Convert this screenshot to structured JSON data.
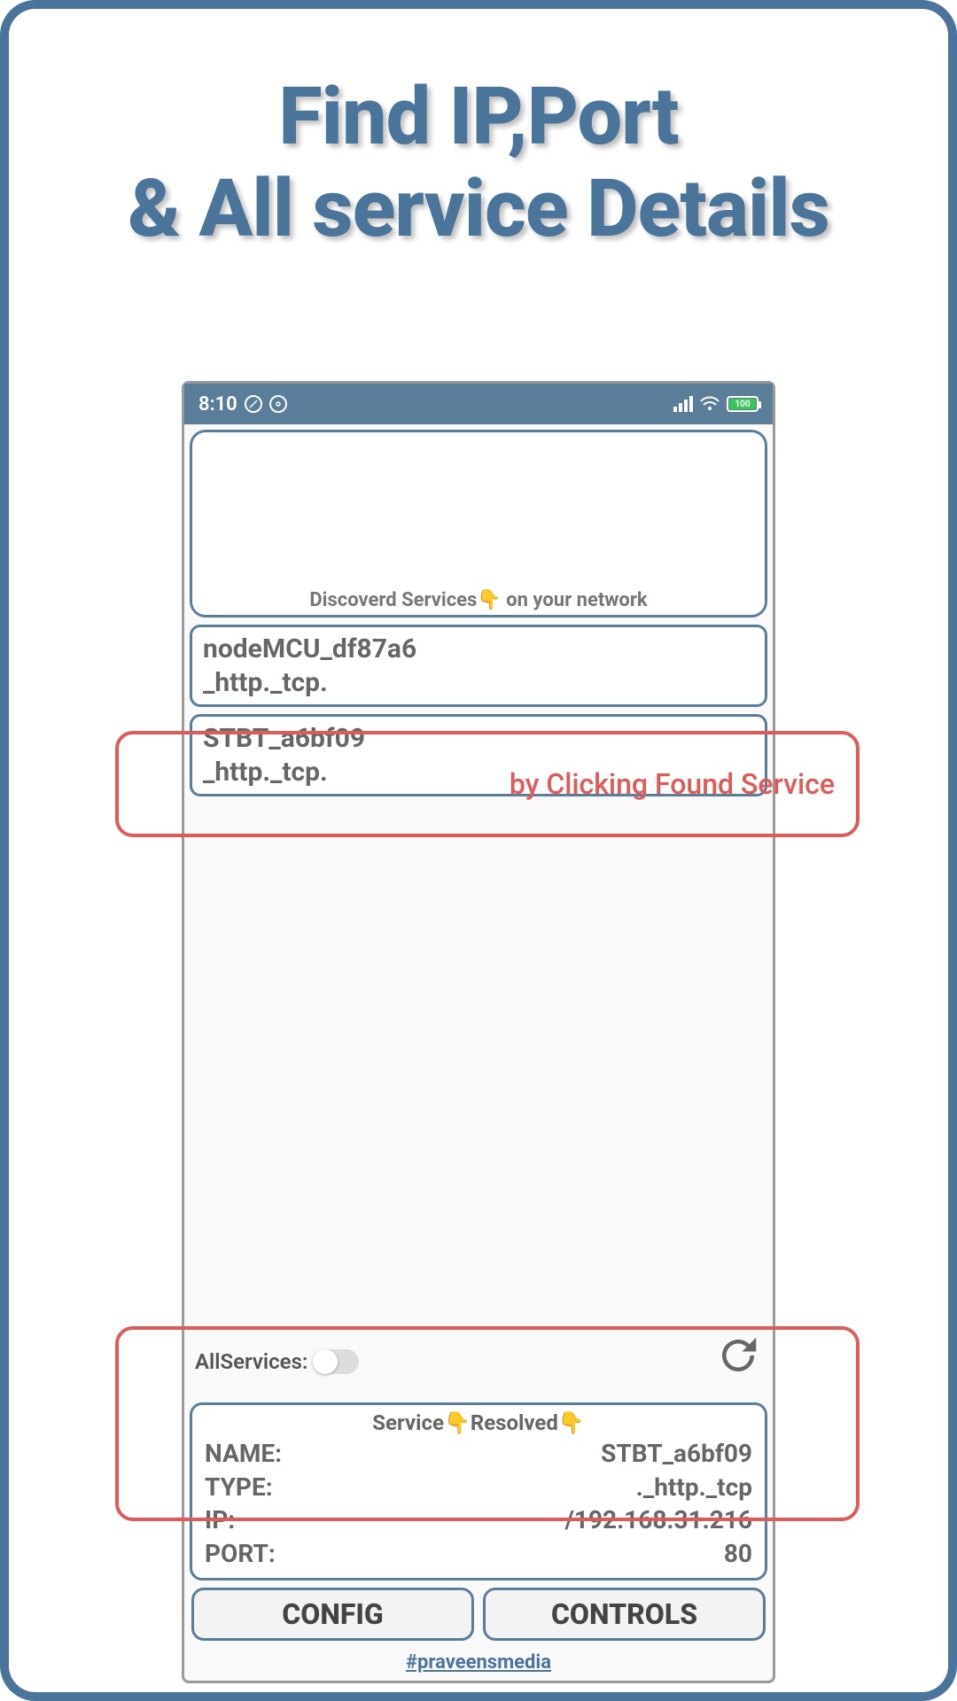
{
  "headline": {
    "line1": "Find IP,Port",
    "line2": "& All service Details"
  },
  "status_bar": {
    "time": "8:10",
    "battery_text": "100"
  },
  "top_card": {
    "label": "Discoverd Services👇 on your network"
  },
  "services": [
    {
      "name": "nodeMCU_df87a6",
      "type": "_http._tcp."
    },
    {
      "name": "STBT_a6bf09",
      "type": "_http._tcp."
    }
  ],
  "allservices": {
    "label": "AllServices:"
  },
  "resolved": {
    "title": "Service👇Resolved👇",
    "rows": [
      {
        "k": "NAME:",
        "v": "STBT_a6bf09"
      },
      {
        "k": "TYPE:",
        "v": "._http._tcp"
      },
      {
        "k": "IP:",
        "v": "/192.168.31.216"
      },
      {
        "k": "PORT:",
        "v": "80"
      }
    ]
  },
  "buttons": {
    "config": "CONFIG",
    "controls": "CONTROLS"
  },
  "footer": {
    "link": "#praveensmedia"
  },
  "annotations": {
    "label1": "by Clicking Found Service"
  }
}
